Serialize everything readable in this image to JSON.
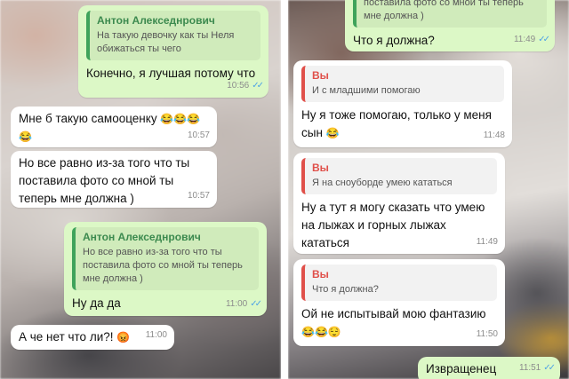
{
  "left": {
    "messages": [
      {
        "quote_author": "Антон Алекседнрович",
        "quote_text": "На такую девочку как ты Неля обижаться ты чего",
        "text": "Конечно, я лучшая потому что",
        "time": "10:56",
        "ticks": "✓✓"
      },
      {
        "text": "Мне б такую самооценку",
        "emoji": "😂😂😂😂",
        "time": "10:57"
      },
      {
        "text": "Но все равно из-за того что ты поставила фото со мной ты теперь мне должна )",
        "time": "10:57"
      },
      {
        "quote_author": "Антон Алекседнрович",
        "quote_text": "Но все равно из-за того что ты поставила фото со мной ты теперь мне должна )",
        "text": "Ну да да",
        "time": "11:00",
        "ticks": "✓✓"
      },
      {
        "text": "А че нет что ли?!",
        "emoji": "😡",
        "time": "11:00"
      }
    ]
  },
  "right": {
    "messages": [
      {
        "quote_text": "поставила фото со мной ты теперь мне должна )",
        "text": "Что я должна?",
        "time": "11:49",
        "ticks": "✓✓"
      },
      {
        "quote_author": "Вы",
        "quote_text": "И с младшими помогаю",
        "text": "Ну я тоже помогаю, только у меня сын",
        "emoji": "😂",
        "time": "11:48"
      },
      {
        "quote_author": "Вы",
        "quote_text": "Я на сноуборде умею кататься",
        "text": "Ну а тут я могу сказать что умею на лыжах и горных лыжах кататься",
        "time": "11:49"
      },
      {
        "quote_author": "Вы",
        "quote_text": "Что я должна?",
        "text": "Ой не испытывай мою фантазию",
        "emoji": "😂😂😌",
        "time": "11:50"
      },
      {
        "text": "Извращенец",
        "time": "11:51",
        "ticks": "✓✓"
      }
    ]
  }
}
